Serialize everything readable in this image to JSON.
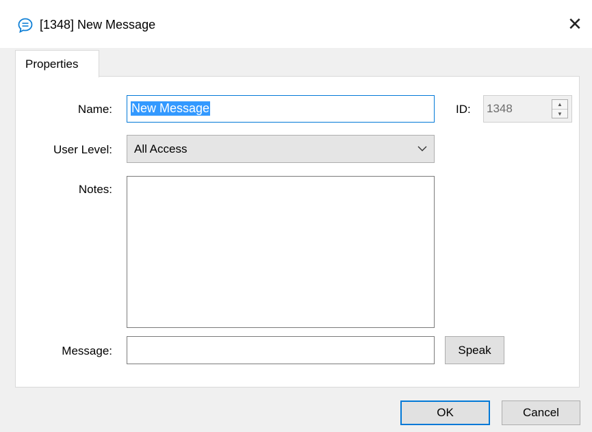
{
  "window": {
    "title": "[1348] New Message",
    "close_symbol": "✕",
    "icon": "chat-bubble-icon",
    "accent_color": "#0078d7"
  },
  "tabs": [
    {
      "label": "Properties",
      "active": true
    }
  ],
  "form": {
    "name_label": "Name:",
    "name_value": "New Message",
    "id_label": "ID:",
    "id_value": "1348",
    "user_level_label": "User Level:",
    "user_level_value": "All Access",
    "notes_label": "Notes:",
    "notes_value": "",
    "message_label": "Message:",
    "message_value": "",
    "speak_label": "Speak"
  },
  "footer": {
    "ok_label": "OK",
    "cancel_label": "Cancel"
  }
}
